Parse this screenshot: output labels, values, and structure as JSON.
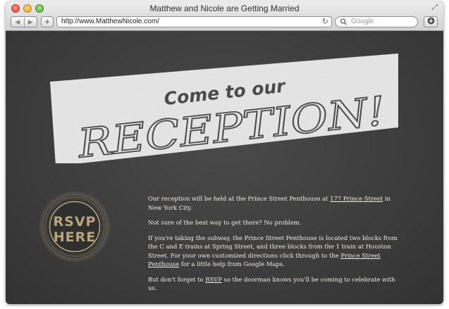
{
  "window": {
    "title": "Matthew and Nicole are Getting Married"
  },
  "toolbar": {
    "back_icon": "◀",
    "forward_icon": "▶",
    "new_tab_label": "+",
    "url": "http://www.MatthewNicole.com/",
    "reload_icon": "↻",
    "search_placeholder": "Google",
    "search_icon": "🔍",
    "download_icon": "⬇"
  },
  "banner": {
    "line1": "Come to our",
    "line2": "RECEPTION!"
  },
  "rsvp": {
    "line1": "RSVP",
    "line2": "HERE"
  },
  "content": {
    "p1_before": "Our reception will be held at the Prince Street Penthouse at ",
    "p1_link": "177 Prince Street",
    "p1_after": " in New York City.",
    "p2": "Not sure of the best way to get there? No problem.",
    "p3_before": "If you're taking the subway, the Prince Street Penthouse is located two blocks from the C and E trains at Spring Street, and three blocks from the 1 train at Houston Street. For your own customized directions click through to the ",
    "p3_link": "Prince Street Penthouse",
    "p3_after": " for a little help from Google Maps.",
    "p4_before": "But don't forget to ",
    "p4_link": "RSVP",
    "p4_after": " so the doorman knows you'll be coming to celebrate with us."
  },
  "colors": {
    "background": "#3c3c3c",
    "banner": "#ebebeb",
    "banner_text": "#4a4a4a",
    "rsvp_gold": "#b9a57a",
    "body_text": "#f1ede2"
  }
}
